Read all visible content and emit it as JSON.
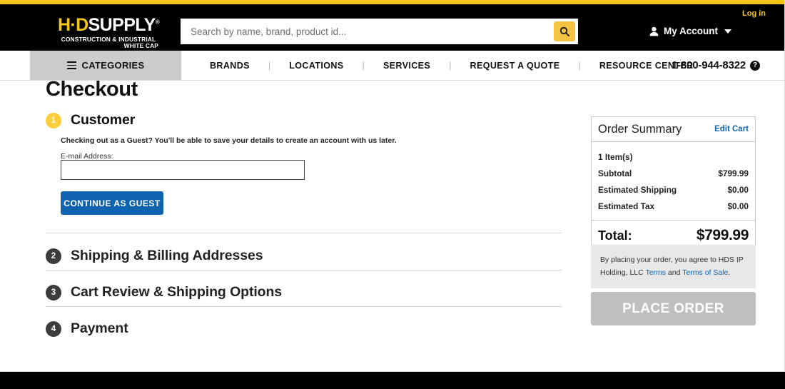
{
  "topbar": {
    "login_label": "Log in",
    "account_label": "My Account"
  },
  "brand": {
    "logo_hd": "H",
    "logo_d": "D",
    "logo_supply": "SUPPLY",
    "logo_reg": "®",
    "logo_line2": "CONSTRUCTION & INDUSTRIAL",
    "logo_line3": "WHITE CAP"
  },
  "search": {
    "placeholder": "Search by name, brand, product id...",
    "value": "",
    "button_icon": "search-icon"
  },
  "nav": {
    "categories_label": "CATEGORIES",
    "items": [
      {
        "label": "BRANDS"
      },
      {
        "label": "LOCATIONS"
      },
      {
        "label": "SERVICES"
      },
      {
        "label": "REQUEST A QUOTE"
      },
      {
        "label": "RESOURCE CENTER"
      }
    ],
    "separator": "|",
    "phone": "1-800-944-8322",
    "help_icon": "?"
  },
  "main": {
    "page_title": "Checkout",
    "steps": [
      {
        "number": "1",
        "title": "Customer",
        "state": "active"
      },
      {
        "number": "2",
        "title": "Shipping & Billing Addresses",
        "state": "inactive"
      },
      {
        "number": "3",
        "title": "Cart Review & Shipping Options",
        "state": "inactive"
      },
      {
        "number": "4",
        "title": "Payment",
        "state": "inactive"
      }
    ],
    "guest_note": "Checking out as a Guest? You'll be able to save your details to create an account with us later.",
    "email_label": "E-mail Address:",
    "email_value": "",
    "email_placeholder": "",
    "continue_guest_label": "CONTINUE AS GUEST"
  },
  "order_summary": {
    "title": "Order Summary",
    "edit_cart_label": "Edit Cart",
    "rows": [
      {
        "label": "1 Item(s)",
        "value": ""
      },
      {
        "label": "Subtotal",
        "value": "$799.99"
      },
      {
        "label": "Estimated Shipping",
        "value": "$0.00"
      },
      {
        "label": "Estimated Tax",
        "value": "$0.00"
      }
    ],
    "total_label": "Total:",
    "total_value": "$799.99",
    "terms_prefix": "By placing your order, you agree to HDS IP Holding, LLC ",
    "terms_link1": "Terms",
    "terms_middle": " and ",
    "terms_link2": "Terms of Sale",
    "terms_suffix": ".",
    "place_order_label": "PLACE ORDER"
  },
  "colors": {
    "brand_yellow": "#F5C518",
    "accent_blue": "#1063AF",
    "step_active": "#FDCE3A",
    "step_inactive": "#3c3c3c",
    "disabled_gray": "#bfbfbf"
  }
}
